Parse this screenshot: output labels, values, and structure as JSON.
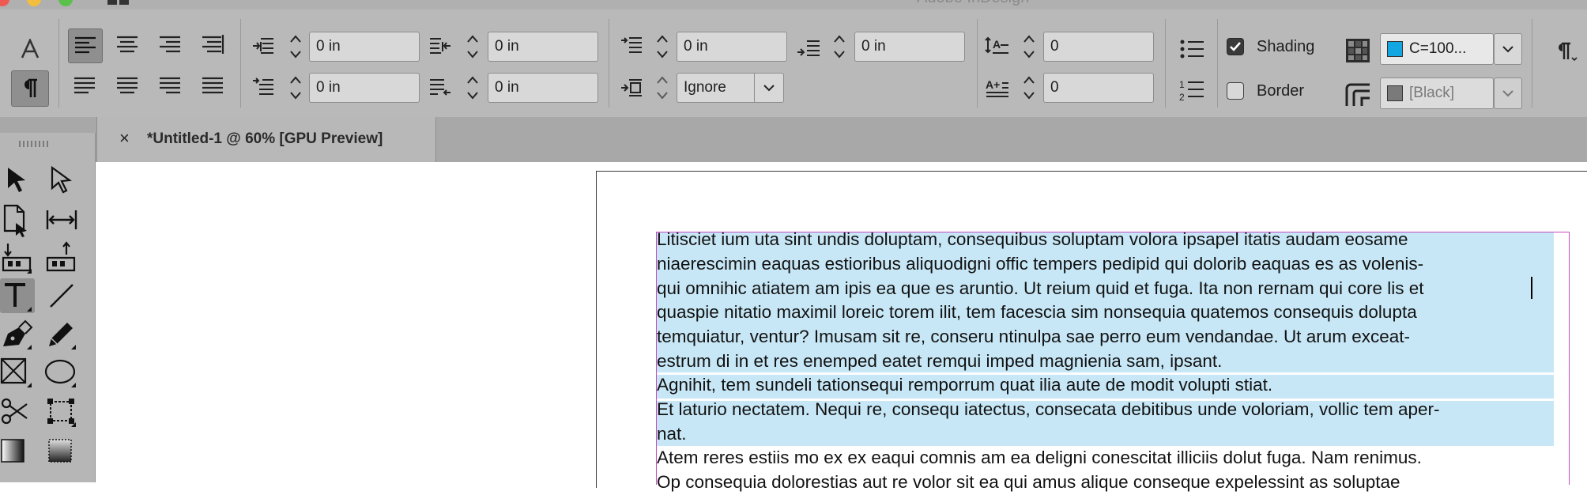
{
  "window": {
    "title_fragment": "Adobe InDesign"
  },
  "control_panel": {
    "row1": {
      "left_indent": "0 in",
      "right_indent": "0 in",
      "space_before": "0 in",
      "drop_cap_lines": "0 in",
      "drop_cap_chars": "0",
      "shading_label": "Shading",
      "shading_checked": true,
      "shading_swatch": "C=100...",
      "shading_swatch_color": "#12a6e3"
    },
    "row2": {
      "first_line_indent": "0 in",
      "last_line_indent": "0 in",
      "align_to_grid": "Ignore",
      "drop_cap_size": "0",
      "border_label": "Border",
      "border_checked": false,
      "border_swatch": "[Black]",
      "border_swatch_color": "#7a7a7a"
    }
  },
  "tab": {
    "close": "×",
    "title": "*Untitled-1 @ 60% [GPU Preview]"
  },
  "document": {
    "paragraphs": [
      {
        "lines": [
          "Litisciet ium uta sint undis doluptam, consequibus soluptam volora ipsapel itatis audam eosame",
          "niaerescimin eaquas estioribus aliquodigni offic tempers pedipid qui dolorib eaquas es as volenis-",
          "qui omnihic atiatem am ipis ea que es aruntio. Ut reium quid et fuga. Ita non rernam qui core lis et",
          "quaspie nitatio maximil loreic torem ilit, tem facescia sim nonsequia quatemos consequis dolupta",
          "temquiatur, ventur? Imusam sit re, conseru ntinulpa sae perro eum vendandae. Ut arum exceat-",
          "estrum di in et res enemped eatet remqui imped magnienia sam, ipsant."
        ]
      },
      {
        "lines": [
          "Agnihit, tem sundeli tationsequi remporrum quat ilia aute de modit volupti stiat."
        ]
      },
      {
        "lines": [
          "Et laturio nectatem. Nequi re, consequ iatectus, consecata debitibus unde voloriam, vollic tem aper-",
          "nat."
        ]
      },
      {
        "lines": [
          "Atem reres estiis mo ex ex eaqui comnis am ea deligni conescitat illiciis dolut fuga. Nam renimus.",
          "Op consequia dolorestias aut re volor sit ea qui amus alique conseque expelessint as soluptae"
        ]
      }
    ]
  },
  "colors": {
    "shading_highlight": "#c7e7f6",
    "frame_edge": "#c64cc1"
  }
}
